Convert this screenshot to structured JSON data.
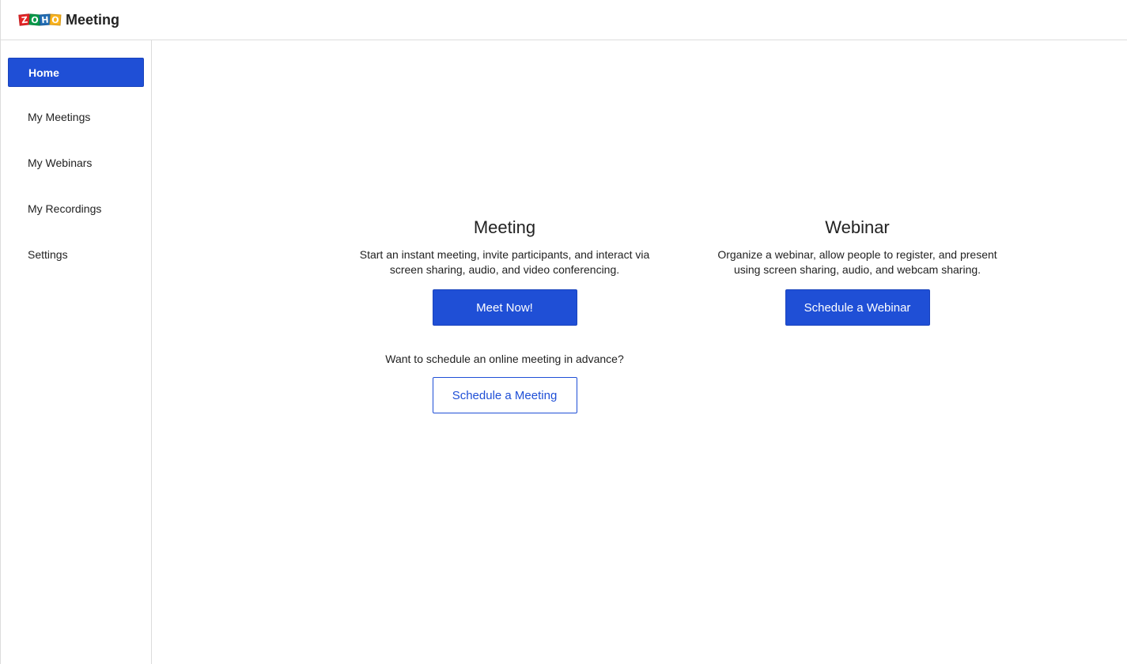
{
  "header": {
    "logo_letters": [
      "Z",
      "O",
      "H",
      "O"
    ],
    "app_name": "Meeting"
  },
  "sidebar": {
    "items": [
      {
        "label": "Home",
        "active": true
      },
      {
        "label": "My Meetings",
        "active": false
      },
      {
        "label": "My Webinars",
        "active": false
      },
      {
        "label": "My Recordings",
        "active": false
      },
      {
        "label": "Settings",
        "active": false
      }
    ]
  },
  "main": {
    "meeting": {
      "title": "Meeting",
      "description": "Start an instant meeting, invite participants, and interact via screen sharing, audio, and video conferencing.",
      "primary_button": "Meet Now!",
      "schedule_prompt": "Want to schedule an online meeting in advance?",
      "schedule_button": "Schedule a Meeting"
    },
    "webinar": {
      "title": "Webinar",
      "description": "Organize a webinar, allow people to register, and present using screen sharing, audio, and webcam sharing.",
      "primary_button": "Schedule a Webinar"
    }
  },
  "colors": {
    "accent": "#1f4fd6",
    "border": "#dcdcdc",
    "text": "#222222",
    "logo_red": "#e42527",
    "logo_green": "#089949",
    "logo_blue": "#226db4",
    "logo_yellow": "#f9b21d"
  }
}
